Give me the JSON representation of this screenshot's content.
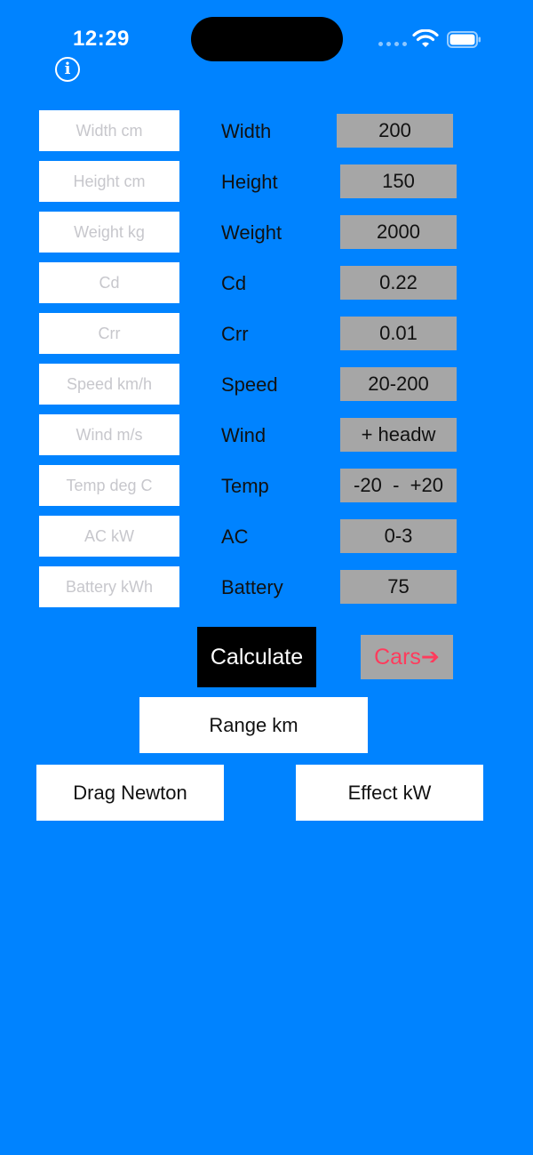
{
  "status_bar": {
    "time": "12:29"
  },
  "fields": [
    {
      "placeholder": "Width cm"
    },
    {
      "placeholder": "Height cm"
    },
    {
      "placeholder": "Weight kg"
    },
    {
      "placeholder": "Cd"
    },
    {
      "placeholder": "Crr"
    },
    {
      "placeholder": "Speed km/h"
    },
    {
      "placeholder": "Wind m/s"
    },
    {
      "placeholder": "Temp deg C"
    },
    {
      "placeholder": "AC kW"
    },
    {
      "placeholder": "Battery kWh"
    }
  ],
  "params": [
    {
      "label": "Width",
      "value": "200"
    },
    {
      "label": "Height",
      "value": "150"
    },
    {
      "label": "Weight",
      "value": "2000"
    },
    {
      "label": "Cd",
      "value": "0.22"
    },
    {
      "label": "Crr",
      "value": "0.01"
    },
    {
      "label": "Speed",
      "value": "20-200"
    },
    {
      "label": "Wind",
      "value": "+ headw"
    },
    {
      "label": "Temp",
      "value": "-20  -  +20"
    },
    {
      "label": "AC",
      "value": "0-3"
    },
    {
      "label": "Battery",
      "value": "75"
    }
  ],
  "buttons": {
    "calculate": "Calculate",
    "cars": "Cars➔"
  },
  "results": {
    "range": "Range km",
    "drag": "Drag Newton",
    "effect": "Effect kW"
  },
  "colors": {
    "background": "#0083FF",
    "value_box": "#A6A6A6",
    "cars_text": "#FF3B5C"
  }
}
